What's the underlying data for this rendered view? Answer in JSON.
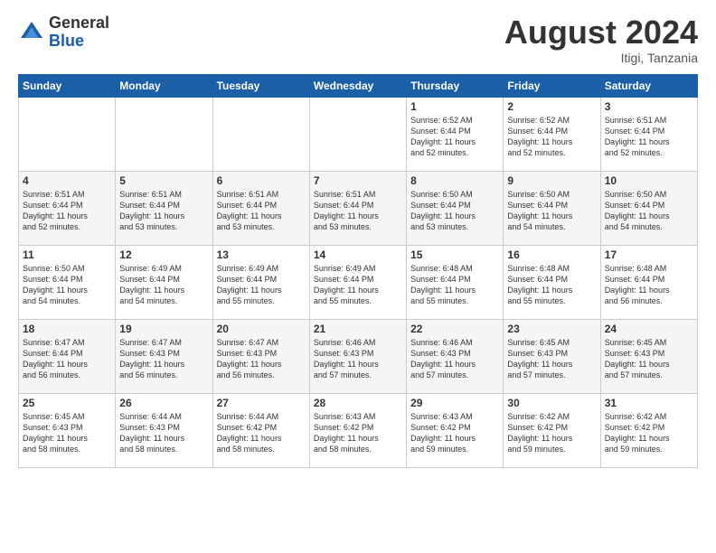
{
  "logo": {
    "general": "General",
    "blue": "Blue"
  },
  "title": "August 2024",
  "location": "Itigi, Tanzania",
  "days_header": [
    "Sunday",
    "Monday",
    "Tuesday",
    "Wednesday",
    "Thursday",
    "Friday",
    "Saturday"
  ],
  "weeks": [
    [
      {
        "day": "",
        "info": ""
      },
      {
        "day": "",
        "info": ""
      },
      {
        "day": "",
        "info": ""
      },
      {
        "day": "",
        "info": ""
      },
      {
        "day": "1",
        "info": "Sunrise: 6:52 AM\nSunset: 6:44 PM\nDaylight: 11 hours\nand 52 minutes."
      },
      {
        "day": "2",
        "info": "Sunrise: 6:52 AM\nSunset: 6:44 PM\nDaylight: 11 hours\nand 52 minutes."
      },
      {
        "day": "3",
        "info": "Sunrise: 6:51 AM\nSunset: 6:44 PM\nDaylight: 11 hours\nand 52 minutes."
      }
    ],
    [
      {
        "day": "4",
        "info": "Sunrise: 6:51 AM\nSunset: 6:44 PM\nDaylight: 11 hours\nand 52 minutes."
      },
      {
        "day": "5",
        "info": "Sunrise: 6:51 AM\nSunset: 6:44 PM\nDaylight: 11 hours\nand 53 minutes."
      },
      {
        "day": "6",
        "info": "Sunrise: 6:51 AM\nSunset: 6:44 PM\nDaylight: 11 hours\nand 53 minutes."
      },
      {
        "day": "7",
        "info": "Sunrise: 6:51 AM\nSunset: 6:44 PM\nDaylight: 11 hours\nand 53 minutes."
      },
      {
        "day": "8",
        "info": "Sunrise: 6:50 AM\nSunset: 6:44 PM\nDaylight: 11 hours\nand 53 minutes."
      },
      {
        "day": "9",
        "info": "Sunrise: 6:50 AM\nSunset: 6:44 PM\nDaylight: 11 hours\nand 54 minutes."
      },
      {
        "day": "10",
        "info": "Sunrise: 6:50 AM\nSunset: 6:44 PM\nDaylight: 11 hours\nand 54 minutes."
      }
    ],
    [
      {
        "day": "11",
        "info": "Sunrise: 6:50 AM\nSunset: 6:44 PM\nDaylight: 11 hours\nand 54 minutes."
      },
      {
        "day": "12",
        "info": "Sunrise: 6:49 AM\nSunset: 6:44 PM\nDaylight: 11 hours\nand 54 minutes."
      },
      {
        "day": "13",
        "info": "Sunrise: 6:49 AM\nSunset: 6:44 PM\nDaylight: 11 hours\nand 55 minutes."
      },
      {
        "day": "14",
        "info": "Sunrise: 6:49 AM\nSunset: 6:44 PM\nDaylight: 11 hours\nand 55 minutes."
      },
      {
        "day": "15",
        "info": "Sunrise: 6:48 AM\nSunset: 6:44 PM\nDaylight: 11 hours\nand 55 minutes."
      },
      {
        "day": "16",
        "info": "Sunrise: 6:48 AM\nSunset: 6:44 PM\nDaylight: 11 hours\nand 55 minutes."
      },
      {
        "day": "17",
        "info": "Sunrise: 6:48 AM\nSunset: 6:44 PM\nDaylight: 11 hours\nand 56 minutes."
      }
    ],
    [
      {
        "day": "18",
        "info": "Sunrise: 6:47 AM\nSunset: 6:44 PM\nDaylight: 11 hours\nand 56 minutes."
      },
      {
        "day": "19",
        "info": "Sunrise: 6:47 AM\nSunset: 6:43 PM\nDaylight: 11 hours\nand 56 minutes."
      },
      {
        "day": "20",
        "info": "Sunrise: 6:47 AM\nSunset: 6:43 PM\nDaylight: 11 hours\nand 56 minutes."
      },
      {
        "day": "21",
        "info": "Sunrise: 6:46 AM\nSunset: 6:43 PM\nDaylight: 11 hours\nand 57 minutes."
      },
      {
        "day": "22",
        "info": "Sunrise: 6:46 AM\nSunset: 6:43 PM\nDaylight: 11 hours\nand 57 minutes."
      },
      {
        "day": "23",
        "info": "Sunrise: 6:45 AM\nSunset: 6:43 PM\nDaylight: 11 hours\nand 57 minutes."
      },
      {
        "day": "24",
        "info": "Sunrise: 6:45 AM\nSunset: 6:43 PM\nDaylight: 11 hours\nand 57 minutes."
      }
    ],
    [
      {
        "day": "25",
        "info": "Sunrise: 6:45 AM\nSunset: 6:43 PM\nDaylight: 11 hours\nand 58 minutes."
      },
      {
        "day": "26",
        "info": "Sunrise: 6:44 AM\nSunset: 6:43 PM\nDaylight: 11 hours\nand 58 minutes."
      },
      {
        "day": "27",
        "info": "Sunrise: 6:44 AM\nSunset: 6:42 PM\nDaylight: 11 hours\nand 58 minutes."
      },
      {
        "day": "28",
        "info": "Sunrise: 6:43 AM\nSunset: 6:42 PM\nDaylight: 11 hours\nand 58 minutes."
      },
      {
        "day": "29",
        "info": "Sunrise: 6:43 AM\nSunset: 6:42 PM\nDaylight: 11 hours\nand 59 minutes."
      },
      {
        "day": "30",
        "info": "Sunrise: 6:42 AM\nSunset: 6:42 PM\nDaylight: 11 hours\nand 59 minutes."
      },
      {
        "day": "31",
        "info": "Sunrise: 6:42 AM\nSunset: 6:42 PM\nDaylight: 11 hours\nand 59 minutes."
      }
    ]
  ]
}
